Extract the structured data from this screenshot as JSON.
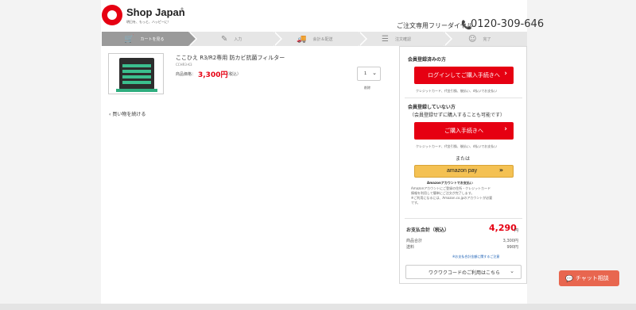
{
  "header": {
    "brand": "Shop Japan",
    "reg": "®",
    "tagline": "明日を、もっと、ハッピーに！",
    "phone_label": "ご注文専用フリーダイヤル",
    "phone_icon": "📞",
    "phone_number": "0120-309-646"
  },
  "steps": [
    {
      "label": "カートを見る",
      "icon": "🛒"
    },
    {
      "label": "入力",
      "icon": "✎"
    },
    {
      "label": "会計＆配送",
      "icon": "🚚"
    },
    {
      "label": "注文確認",
      "icon": "☰"
    },
    {
      "label": "完了",
      "icon": "☺"
    }
  ],
  "product": {
    "name": "ここひえ R3/R2専用 防カビ抗菌フィルター",
    "code": "CCHR3-K3",
    "price_label": "商品価格：",
    "price": "3,300円",
    "tax": "（税込）",
    "qty": "1",
    "delete_label": "削除"
  },
  "continue_label": "買い物を続ける",
  "panel": {
    "member_title": "会員登録済みの方",
    "login_button": "ログインしてご購入手続きへ",
    "pay_methods_1": "クレジットカード、代金引換、後払い、d払いでお支払い",
    "guest_title": "会員登録していない方",
    "guest_sub": "（会員登録せずに購入することも可能です）",
    "guest_button": "ご購入手続きへ",
    "pay_methods_2": "クレジットカード、代金引換、後払い、d払いでお支払い",
    "or": "または",
    "amazon_label": "amazon pay",
    "amazon_title": "Amazonアカウントでお支払い",
    "amazon_desc_1": "Amazonアカウントにご登録の住所・クレジットカード",
    "amazon_desc_2": "情報を利用して簡単にご注文が完了します。",
    "amazon_desc_3": "※ご利用になるには、Amazon.co.jpのアカウントが必要",
    "amazon_desc_4": "です。",
    "total_label": "お支払合計（税込）",
    "total": "4,290",
    "total_unit": "円",
    "subtotal_label": "商品合計",
    "subtotal": "3,300円",
    "shipping_label": "送料",
    "shipping": "990円",
    "link": "※お支払合計金額に関するご注意",
    "coupon": "ワクワクコードのご利用はこちら"
  },
  "chat": {
    "label": "チャット相談",
    "icon": "💬"
  },
  "colors": {
    "accent": "#e60012",
    "chat": "#e8664f",
    "amazon": "#f4c153"
  }
}
